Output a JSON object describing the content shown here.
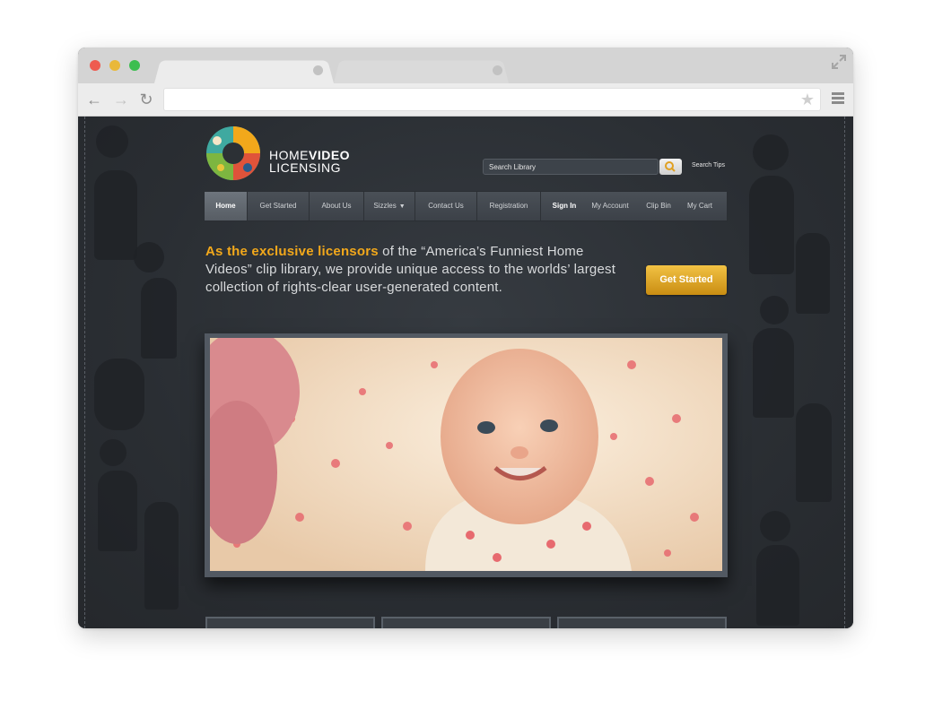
{
  "browser": {
    "window_controls": [
      "close",
      "minimize",
      "zoom"
    ],
    "tabs": [
      "",
      ""
    ],
    "address_bar": "",
    "icons": [
      "back-icon",
      "forward-icon",
      "reload-icon",
      "star-icon",
      "menu-icon",
      "expand-icon"
    ]
  },
  "site": {
    "logo": {
      "home": "HOME",
      "video": "VIDEO",
      "licensing": "LICENSING"
    },
    "search": {
      "placeholder": "Search Library",
      "tips": "Search Tips"
    },
    "nav": [
      {
        "label": "Home",
        "active": true
      },
      {
        "label": "Get Started"
      },
      {
        "label": "About Us"
      },
      {
        "label": "Sizzles",
        "dropdown": true
      },
      {
        "label": "Contact Us"
      },
      {
        "label": "Registration"
      },
      {
        "label": "Sign In"
      },
      {
        "label": "My Account"
      },
      {
        "label": "Clip Bin"
      },
      {
        "label": "My Cart"
      }
    ],
    "intro": {
      "highlight": "As the exclusive licensors",
      "rest": " of the “America’s Funniest Home Videos” clip library, we provide unique access to the worlds’ largest collection of rights-clear user-generated content."
    },
    "cta": "Get Started"
  },
  "colors": {
    "accent_orange": "#f2a81b",
    "cta_gold": "#e0a82a",
    "page_bg": "#2c3035"
  }
}
